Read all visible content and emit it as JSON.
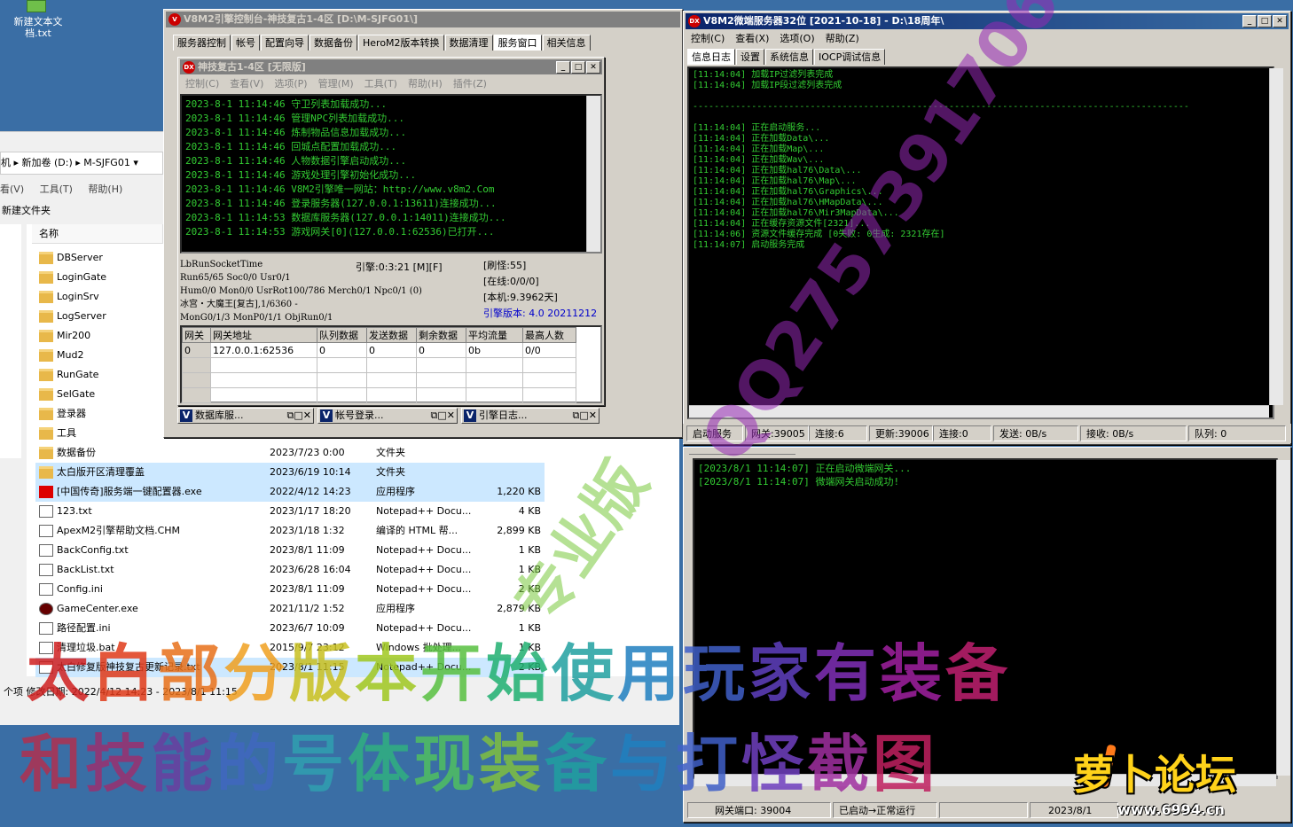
{
  "desktop": {
    "icon_label": "新建文本文档.txt"
  },
  "control_window": {
    "title": "V8M2引擎控制台-神技复古1-4区 [D:\\M-SJFG01\\]",
    "tabs": [
      "服务器控制",
      "帐号",
      "配置向导",
      "数据备份",
      "HeroM2版本转换",
      "数据清理",
      "服务窗口",
      "相关信息"
    ],
    "active_tab": "服务窗口"
  },
  "engine_window": {
    "title": "神技复古1-4区 [无限版]",
    "menu": [
      "控制(C)",
      "查看(V)",
      "选项(P)",
      "管理(M)",
      "工具(T)",
      "帮助(H)",
      "插件(Z)"
    ],
    "log": [
      "2023-8-1  11:14:46 守卫列表加载成功...",
      "2023-8-1  11:14:46 管理NPC列表加载成功...",
      "2023-8-1  11:14:46 炼制物品信息加载成功...",
      "2023-8-1  11:14:46 回城点配置加载成功...",
      "2023-8-1  11:14:46 人物数据引擎启动成功...",
      "2023-8-1  11:14:46 游戏处理引擎初始化成功...",
      "2023-8-1  11:14:46 V8M2引擎唯一网站：http://www.v8m2.Com",
      "2023-8-1  11:14:46 登录服务器(127.0.0.1:13611)连接成功...",
      "2023-8-1  11:14:53 数据库服务器(127.0.0.1:14011)连接成功...",
      "2023-8-1  11:14:53 游戏网关[0](127.0.0.1:62536)已打开..."
    ],
    "stats_left": [
      "LbRunSocketTime",
      "Run65/65 Soc0/0 Usr0/1",
      "Hum0/0 Mon0/0 UsrRot100/786 Merch0/1 Npc0/1  (0)",
      "冰宫・大魔王[复古],1/6360 -",
      "MonG0/1/3 MonP0/1/1 ObjRun0/1"
    ],
    "engine_time": "引擎:0:3:21  [M][F]",
    "stats_right": [
      "[刷怪:55]",
      "[在线:0/0/0]",
      "[本机:9.3962天]"
    ],
    "engine_version": "引擎版本: 4.0 20211212",
    "grid_headers": [
      "网关",
      "网关地址",
      "队列数据",
      "发送数据",
      "剩余数据",
      "平均流量",
      "最高人数"
    ],
    "grid_rows": [
      [
        "0",
        "127.0.0.1:62536",
        "0",
        "0",
        "0",
        "0b",
        "0/0"
      ]
    ],
    "mini_windows": [
      "数据库服...",
      "帐号登录...",
      "引擎日志..."
    ]
  },
  "explorer": {
    "path": [
      "机",
      "新加卷 (D:)",
      "M-SJFG01"
    ],
    "menu": [
      "看(V)",
      "工具(T)",
      "帮助(H)"
    ],
    "new_folder": "新建文件夹",
    "column_name": "名称",
    "files": [
      {
        "name": "DBServer",
        "date": "",
        "type": "",
        "size": "",
        "icon": "folder"
      },
      {
        "name": "LoginGate",
        "date": "",
        "type": "",
        "size": "",
        "icon": "folder"
      },
      {
        "name": "LoginSrv",
        "date": "",
        "type": "",
        "size": "",
        "icon": "folder"
      },
      {
        "name": "LogServer",
        "date": "",
        "type": "",
        "size": "",
        "icon": "folder"
      },
      {
        "name": "Mir200",
        "date": "",
        "type": "",
        "size": "",
        "icon": "folder"
      },
      {
        "name": "Mud2",
        "date": "",
        "type": "",
        "size": "",
        "icon": "folder"
      },
      {
        "name": "RunGate",
        "date": "",
        "type": "",
        "size": "",
        "icon": "folder"
      },
      {
        "name": "SelGate",
        "date": "",
        "type": "",
        "size": "",
        "icon": "folder"
      },
      {
        "name": "登录器",
        "date": "",
        "type": "",
        "size": "",
        "icon": "folder"
      },
      {
        "name": "工具",
        "date": "",
        "type": "",
        "size": "",
        "icon": "folder"
      },
      {
        "name": "数据备份",
        "date": "2023/7/23 0:00",
        "type": "文件夹",
        "size": "",
        "icon": "folder"
      },
      {
        "name": "太白版开区清理覆盖",
        "date": "2023/6/19 10:14",
        "type": "文件夹",
        "size": "",
        "icon": "folder"
      },
      {
        "name": "[中国传奇]服务端一键配置器.exe",
        "date": "2022/4/12 14:23",
        "type": "应用程序",
        "size": "1,220 KB",
        "icon": "flag"
      },
      {
        "name": "123.txt",
        "date": "2023/1/17 18:20",
        "type": "Notepad++ Docu...",
        "size": "4 KB",
        "icon": "txt"
      },
      {
        "name": "ApexM2引擎帮助文档.CHM",
        "date": "2023/1/18 1:32",
        "type": "编译的 HTML 帮...",
        "size": "2,899 KB",
        "icon": "chm"
      },
      {
        "name": "BackConfig.txt",
        "date": "2023/8/1 11:09",
        "type": "Notepad++ Docu...",
        "size": "1 KB",
        "icon": "txt"
      },
      {
        "name": "BackList.txt",
        "date": "2023/6/28 16:04",
        "type": "Notepad++ Docu...",
        "size": "1 KB",
        "icon": "txt"
      },
      {
        "name": "Config.ini",
        "date": "2023/8/1 11:09",
        "type": "Notepad++ Docu...",
        "size": "2 KB",
        "icon": "txt"
      },
      {
        "name": "GameCenter.exe",
        "date": "2021/11/2 1:52",
        "type": "应用程序",
        "size": "2,879 KB",
        "icon": "exe"
      },
      {
        "name": "路径配置.ini",
        "date": "2023/6/7 10:09",
        "type": "Notepad++ Docu...",
        "size": "1 KB",
        "icon": "txt"
      },
      {
        "name": "清理垃圾.bat",
        "date": "2015/9/7 23:12",
        "type": "Windows 批处理...",
        "size": "1 KB",
        "icon": "bat"
      },
      {
        "name": "太白修复版神技复古更新记录.txt",
        "date": "2023/8/1 11:15",
        "type": "Notepad++ Docu...",
        "size": "2 KB",
        "icon": "txt"
      }
    ],
    "status": "个项  修改日期: 2022/4/12 14:23 - 2023/8/1 11:15"
  },
  "microgate_window": {
    "title": "V8M2微端服务器32位  [2021-10-18]  - D:\\18周年\\",
    "menu": [
      "控制(C)",
      "查看(X)",
      "选项(O)",
      "帮助(Z)"
    ],
    "tabs": [
      "信息日志",
      "设置",
      "系统信息",
      "IOCP调试信息"
    ],
    "active_tab": "信息日志",
    "log": [
      "[11:14:04] 加载IP过滤列表完成",
      "[11:14:04] 加载IP段过滤列表完成",
      "",
      "---------------------------------------------------------------------------------------------",
      "",
      "[11:14:04] 正在启动服务...",
      "[11:14:04] 正在加载Data\\...",
      "[11:14:04] 正在加载Map\\...",
      "[11:14:04] 正在加载Wav\\...",
      "[11:14:04] 正在加载hal76\\Data\\...",
      "[11:14:04] 正在加载hal76\\Map\\...",
      "[11:14:04] 正在加载hal76\\Graphics\\...",
      "[11:14:04] 正在加载hal76\\HMapData\\...",
      "[11:14:04] 正在加载hal76\\Mir3MapData\\...",
      "[11:14:04] 正在缓存资源文件[2321]...",
      "[11:14:06] 资源文件缓存完成 [0失败: 0生成: 2321存在]",
      "[11:14:07] 启动服务完成"
    ],
    "status": [
      "启动服务",
      "网关:39005",
      "连接:6",
      "更新:39006",
      "连接:0",
      "发送: 0B/s",
      "接收: 0B/s",
      "队列: 0"
    ],
    "gate_log": [
      "[2023/8/1  11:14:07] 正在启动微端网关...",
      "[2023/8/1  11:14:07] 微端网关启动成功!"
    ],
    "bottom_status": [
      "网关端口: 39004",
      "已启动→正常运行",
      "",
      "2023/8/1"
    ]
  },
  "overlays": {
    "line1": "太白部分版本开始使用玩家有装备",
    "line2": "和技能的号体现装备与打怪截图",
    "diagonal_qq": "QQ2757391706",
    "diagonal_ver": "专业版",
    "logo_text": "萝卜论坛",
    "logo_url": "www.6994.cn"
  }
}
